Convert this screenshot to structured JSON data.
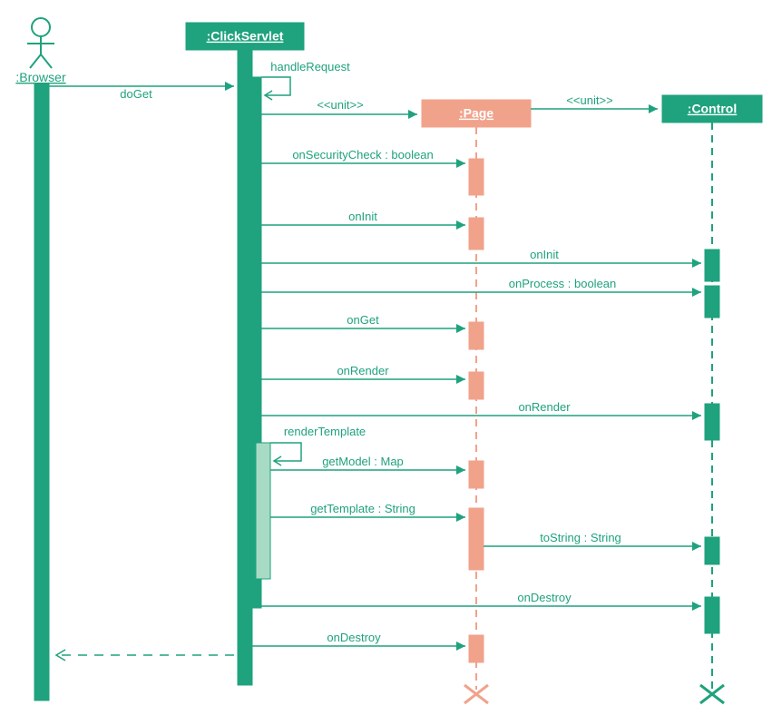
{
  "actors": {
    "browser": ":Browser",
    "clickservlet": ":ClickServlet",
    "page": ":Page",
    "control": ":Control"
  },
  "messages": {
    "doGet": "doGet",
    "handleRequest": "handleRequest",
    "unit1": "<<unit>>",
    "unit2": "<<unit>>",
    "onSecurityCheck": "onSecurityCheck : boolean",
    "onInit1": "onInit",
    "onInit2": "onInit",
    "onProcess": "onProcess : boolean",
    "onGet": "onGet",
    "onRender1": "onRender",
    "onRender2": "onRender",
    "renderTemplate": "renderTemplate",
    "getModel": "getModel : Map",
    "getTemplate": "getTemplate : String",
    "toString": "toString : String",
    "onDestroy1": "onDestroy",
    "onDestroy2": "onDestroy",
    "return": ""
  },
  "diagram_type": "UML Sequence Diagram",
  "colors": {
    "green": "#1fa27e",
    "lightgreen": "#a8dbc5",
    "salmon": "#f1a28b"
  }
}
